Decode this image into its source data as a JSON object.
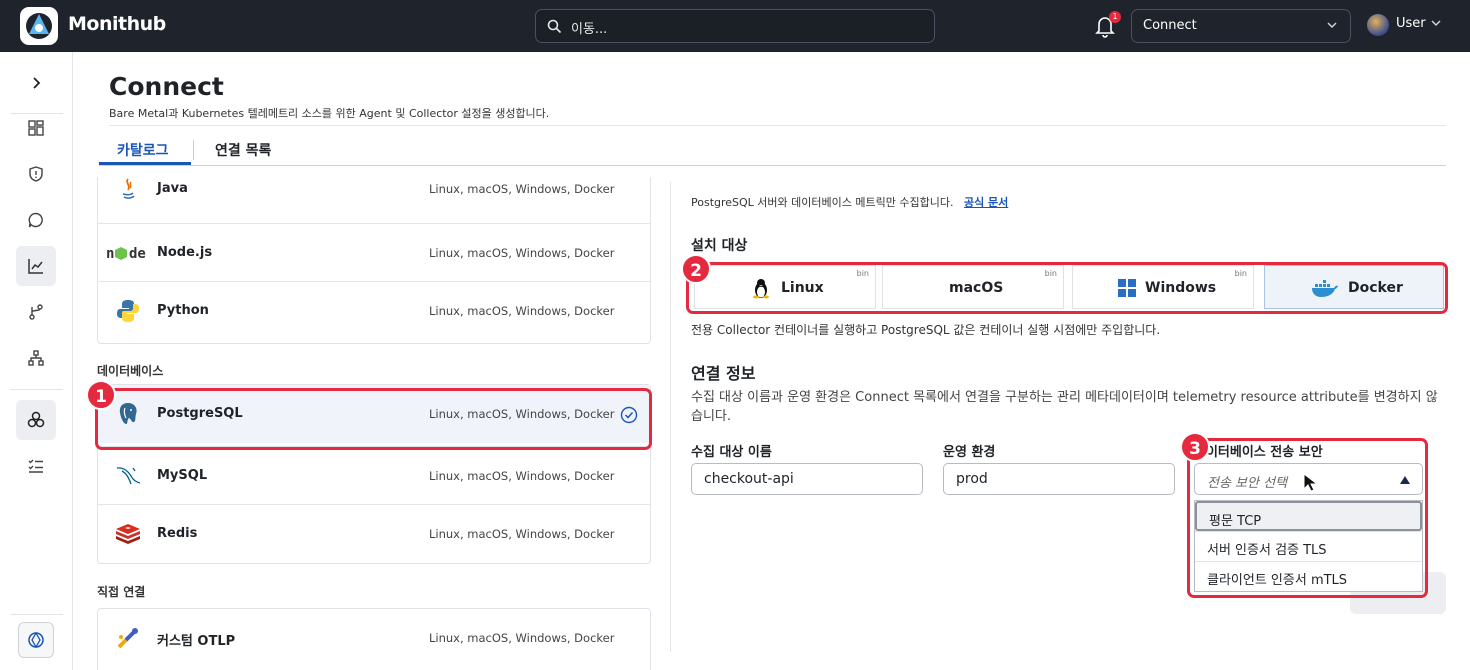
{
  "app": {
    "brand": "Monithub",
    "search_placeholder": "이동...",
    "notif_count": "1",
    "context_select": "Connect",
    "user": "User"
  },
  "page": {
    "title": "Connect",
    "subtitle": "Bare Metal과 Kubernetes 텔레메트리 소스를 위한 Agent 및 Collector 설정을 생성합니다.",
    "tabs": [
      "카탈로그",
      "연결 목록"
    ]
  },
  "catalog": {
    "apps": [
      {
        "name": "Java",
        "platforms": "Linux, macOS, Windows, Docker",
        "icon": "java-icon"
      },
      {
        "name": "Node.js",
        "platforms": "Linux, macOS, Windows, Docker",
        "icon": "nodejs-icon"
      },
      {
        "name": "Python",
        "platforms": "Linux, macOS, Windows, Docker",
        "icon": "python-icon"
      }
    ],
    "db_section": "데이터베이스",
    "databases": [
      {
        "name": "PostgreSQL",
        "platforms": "Linux, macOS, Windows, Docker",
        "icon": "postgresql-icon",
        "selected": true
      },
      {
        "name": "MySQL",
        "platforms": "Linux, macOS, Windows, Docker",
        "icon": "mysql-icon"
      },
      {
        "name": "Redis",
        "platforms": "Linux, macOS, Windows, Docker",
        "icon": "redis-icon"
      }
    ],
    "direct_section": "직접 연결",
    "direct": [
      {
        "name": "커스텀 OTLP",
        "platforms": "Linux, macOS, Windows, Docker",
        "icon": "otlp-icon"
      }
    ]
  },
  "detail": {
    "description": "PostgreSQL 서버와 데이터베이스 메트릭만 수집합니다.",
    "doc_link": "공식 문서",
    "install_target_title": "설치 대상",
    "targets": [
      {
        "label": "Linux",
        "badge": "bin"
      },
      {
        "label": "macOS",
        "badge": "bin"
      },
      {
        "label": "Windows",
        "badge": "bin"
      },
      {
        "label": "Docker",
        "badge": "",
        "active": true
      }
    ],
    "target_note": "전용 Collector 컨테이너를 실행하고 PostgreSQL 값은 컨테이너 실행 시점에만 주입합니다.",
    "conn_title": "연결 정보",
    "conn_info": "수집 대상 이름과 운영 환경은 Connect 목록에서 연결을 구분하는 관리 메타데이터이며 telemetry resource attribute를 변경하지 않습니다.",
    "fields": {
      "target_name_label": "수집 대상 이름",
      "target_name_value": "checkout-api",
      "env_label": "운영 환경",
      "env_value": "prod",
      "security_label": "데이터베이스 전송 보안",
      "security_placeholder": "전송 보안 선택",
      "security_options": [
        "평문 TCP",
        "서버 인증서 검증 TLS",
        "클라이언트 인증서 mTLS"
      ]
    }
  },
  "annotations": [
    "1",
    "2",
    "3"
  ],
  "colors": {
    "accent": "#1a56b8",
    "highlight": "#e5293f",
    "topbar": "#1f232b"
  }
}
